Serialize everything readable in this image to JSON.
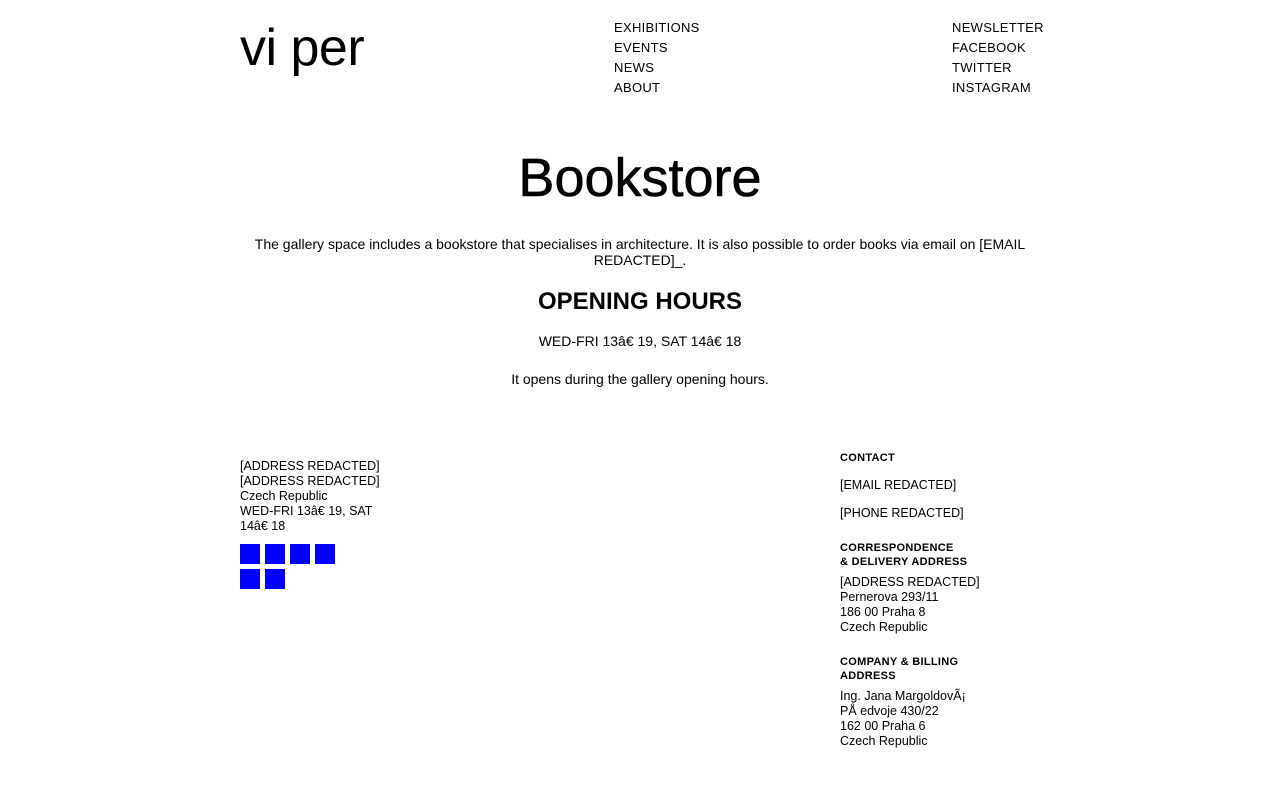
{
  "header": {
    "logo": "vi per",
    "nav_main": [
      "EXHIBITIONS",
      "EVENTS",
      "NEWS",
      "ABOUT"
    ],
    "nav_social": [
      "NEWSLETTER",
      "FACEBOOK",
      "TWITTER",
      "INSTAGRAM"
    ]
  },
  "main": {
    "title": "Bookstore",
    "intro": "The gallery space includes a bookstore that specialises in architecture. It is also possible to order books via email on [EMAIL REDACTED]_.",
    "hours_heading": "OPENING HOURS",
    "hours_value": "WED-FRI 13â€   19, SAT 14â€   18",
    "hours_note": "It opens during the gallery opening hours."
  },
  "footer": {
    "address_lines": [
      "[ADDRESS REDACTED]",
      "[ADDRESS REDACTED]",
      "Czech Republic"
    ],
    "hours_line1": "WED-FRI 13â€   19, SAT",
    "hours_line2": "14â€   18",
    "social_icons": [
      "social-icon",
      "social-icon",
      "social-icon",
      "social-icon",
      "social-icon",
      "social-icon"
    ],
    "icon_color": "#0000ff",
    "contact": {
      "heading": "CONTACT",
      "email": "[EMAIL REDACTED]",
      "phone": "[PHONE REDACTED]"
    },
    "correspondence": {
      "heading_line1": "CORRESPONDENCE",
      "heading_line2": "& DELIVERY ADDRESS",
      "lines": [
        "[ADDRESS REDACTED]",
        "Pernerova 293/11",
        "186 00 Praha 8",
        "Czech Republic"
      ]
    },
    "billing": {
      "heading_line1": "COMPANY & BILLING",
      "heading_line2": "ADDRESS",
      "lines": [
        "Ing. Jana MargoldovÃ¡",
        "PÅ   edvoje 430/22",
        "162 00 Praha 6",
        "Czech Republic"
      ]
    }
  }
}
